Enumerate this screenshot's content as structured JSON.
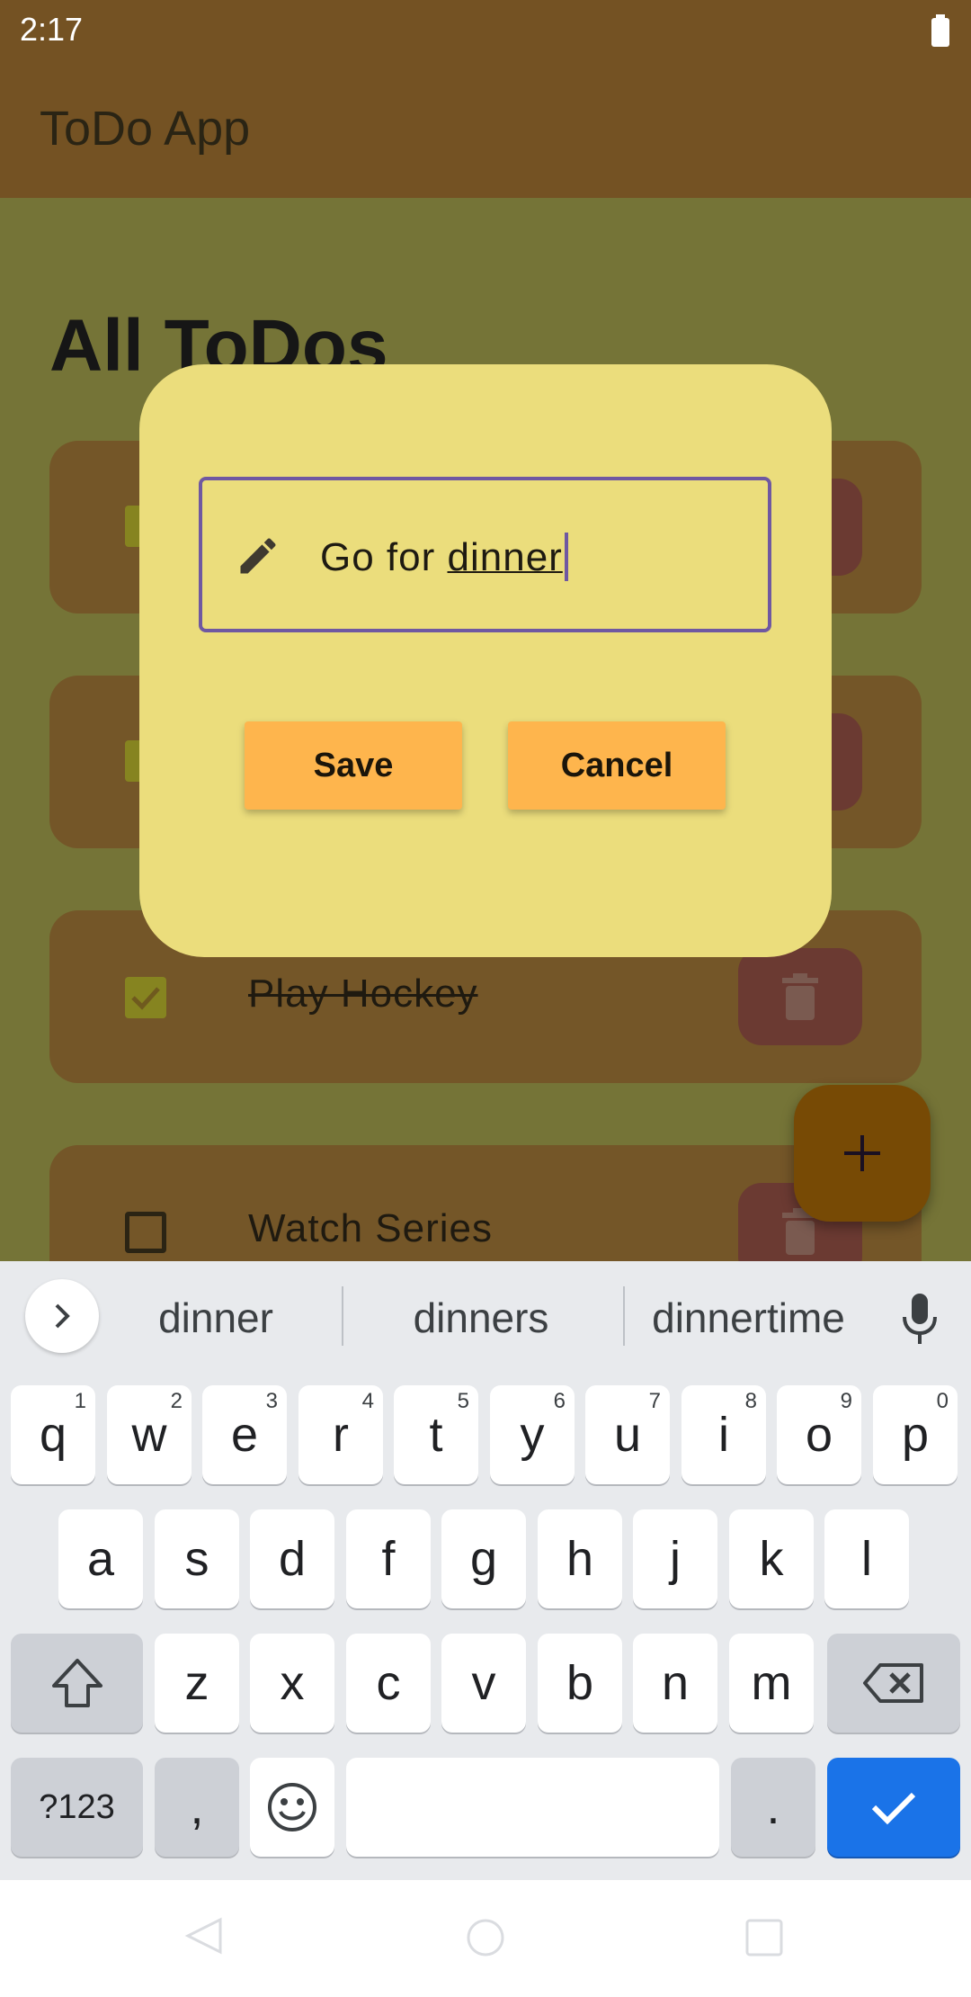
{
  "status_bar": {
    "time": "2:17"
  },
  "app_bar": {
    "title": "ToDo App"
  },
  "screen": {
    "heading": "All ToDos"
  },
  "todos": [
    {
      "label": "",
      "done": true
    },
    {
      "label": "",
      "done": true
    },
    {
      "label": "Play Hockey",
      "done": true
    },
    {
      "label": "Watch Series",
      "done": false
    }
  ],
  "dialog": {
    "input_value_plain": "Go for ",
    "input_value_composing": "dinner",
    "save_label": "Save",
    "cancel_label": "Cancel"
  },
  "keyboard": {
    "suggestions": [
      "dinner",
      "dinners",
      "dinnertime"
    ],
    "row1": [
      {
        "key": "q",
        "hint": "1"
      },
      {
        "key": "w",
        "hint": "2"
      },
      {
        "key": "e",
        "hint": "3"
      },
      {
        "key": "r",
        "hint": "4"
      },
      {
        "key": "t",
        "hint": "5"
      },
      {
        "key": "y",
        "hint": "6"
      },
      {
        "key": "u",
        "hint": "7"
      },
      {
        "key": "i",
        "hint": "8"
      },
      {
        "key": "o",
        "hint": "9"
      },
      {
        "key": "p",
        "hint": "0"
      }
    ],
    "row2": [
      "a",
      "s",
      "d",
      "f",
      "g",
      "h",
      "j",
      "k",
      "l"
    ],
    "row3": [
      "z",
      "x",
      "c",
      "v",
      "b",
      "n",
      "m"
    ],
    "symbols_key": "?123",
    "comma_key": ",",
    "period_key": "."
  },
  "icons": {
    "battery": "battery-icon",
    "checkbox_checked": "check-icon",
    "delete": "trash-icon",
    "fab": "plus-icon",
    "edit": "pencil-icon",
    "expand": "chevron-right-icon",
    "mic": "mic-icon",
    "shift": "shift-icon",
    "backspace": "backspace-icon",
    "emoji": "emoji-icon",
    "enter": "check-icon"
  },
  "colors": {
    "app_bar": "#745223",
    "dialog": "#ebdd7c",
    "button": "#feb54d",
    "field_border": "#6f58a1",
    "enter_key": "#1a73e8"
  }
}
